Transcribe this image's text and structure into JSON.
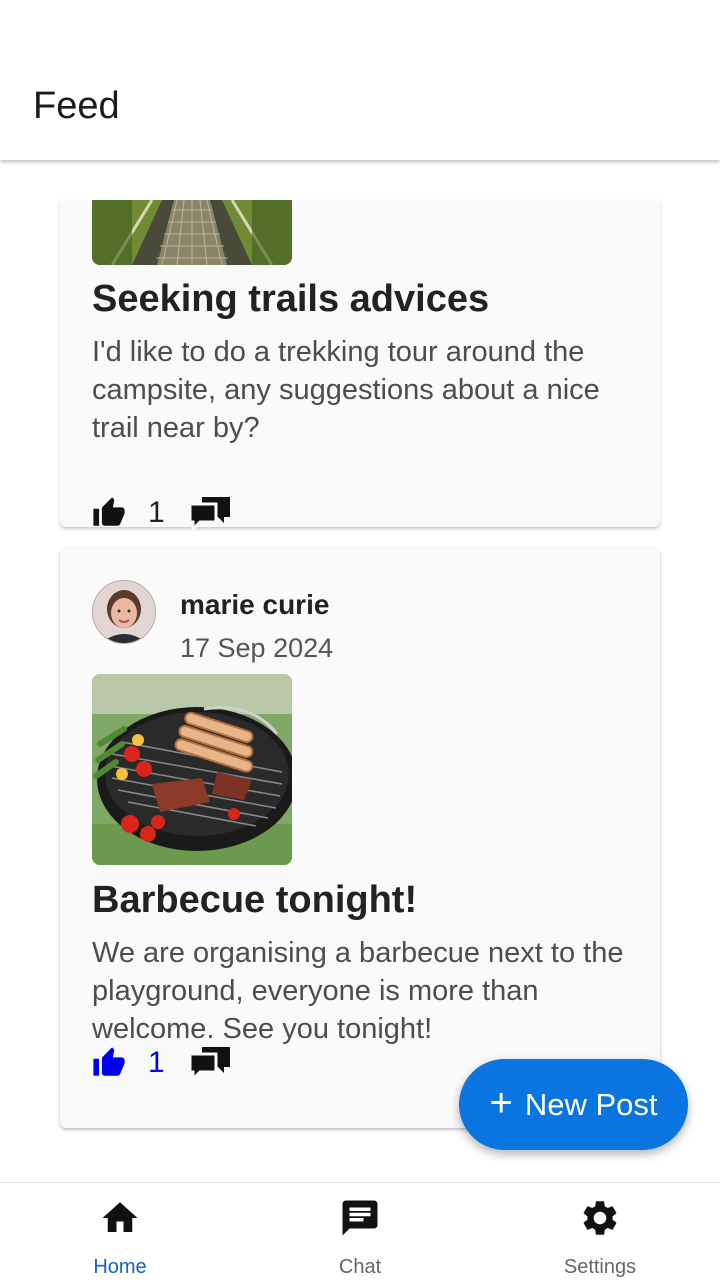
{
  "header": {
    "title": "Feed"
  },
  "posts": [
    {
      "title": "Seeking trails advices",
      "body": "I'd like to do a trekking tour around the campsite, any suggestions about a nice trail near by?",
      "likes": "1",
      "liked": false,
      "image": "suspension-bridge-photo"
    },
    {
      "author": "marie curie",
      "date": "17 Sep 2024",
      "title": "Barbecue tonight!",
      "body": "We are organising a barbecue next to the playground, everyone is more than welcome. See you tonight!",
      "likes": "1",
      "liked": true,
      "image": "barbecue-grill-photo"
    }
  ],
  "fab": {
    "icon": "plus-icon",
    "label": "New Post"
  },
  "bottom_nav": {
    "items": [
      {
        "label": "Home",
        "icon": "home-icon",
        "active": true
      },
      {
        "label": "Chat",
        "icon": "chat-icon",
        "active": false
      },
      {
        "label": "Settings",
        "icon": "gear-icon",
        "active": false
      }
    ]
  },
  "colors": {
    "accent": "#0a74e0",
    "liked": "#0000ee",
    "active_nav": "#1565c0"
  }
}
